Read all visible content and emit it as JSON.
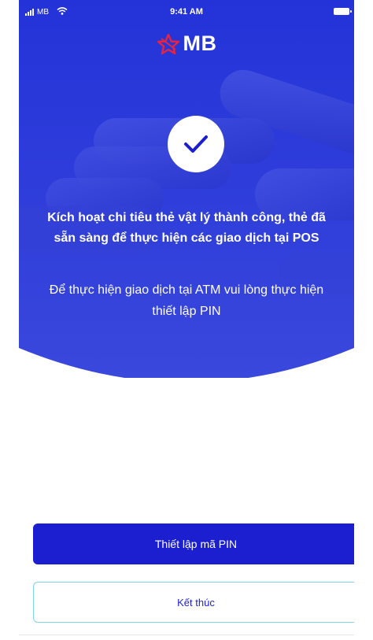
{
  "colors": {
    "brand_blue": "#1b1fd0",
    "hero_blue": "#2e3bd6",
    "logo_red": "#e8233f",
    "secondary_border": "#7fd6e4",
    "text_on_blue": "#ffffff"
  },
  "status_bar": {
    "carrier": "MB",
    "time": "9:41 AM",
    "icons": [
      "signal-icon",
      "wifi-icon",
      "battery-icon"
    ]
  },
  "header": {
    "logo_text": "MB",
    "logo_icon": "mb-star-icon"
  },
  "success": {
    "icon": "checkmark-icon",
    "title": "Kích hoạt chi tiêu thẻ vật lý thành công, thẻ đã sẵn sàng để thực hiện các giao dịch tại POS",
    "subtitle": "Để thực hiện giao dịch tại ATM vui lòng thực hiện thiết lập PIN"
  },
  "actions": {
    "primary_label": "Thiết lập mã PIN",
    "secondary_label": "Kết thúc"
  }
}
